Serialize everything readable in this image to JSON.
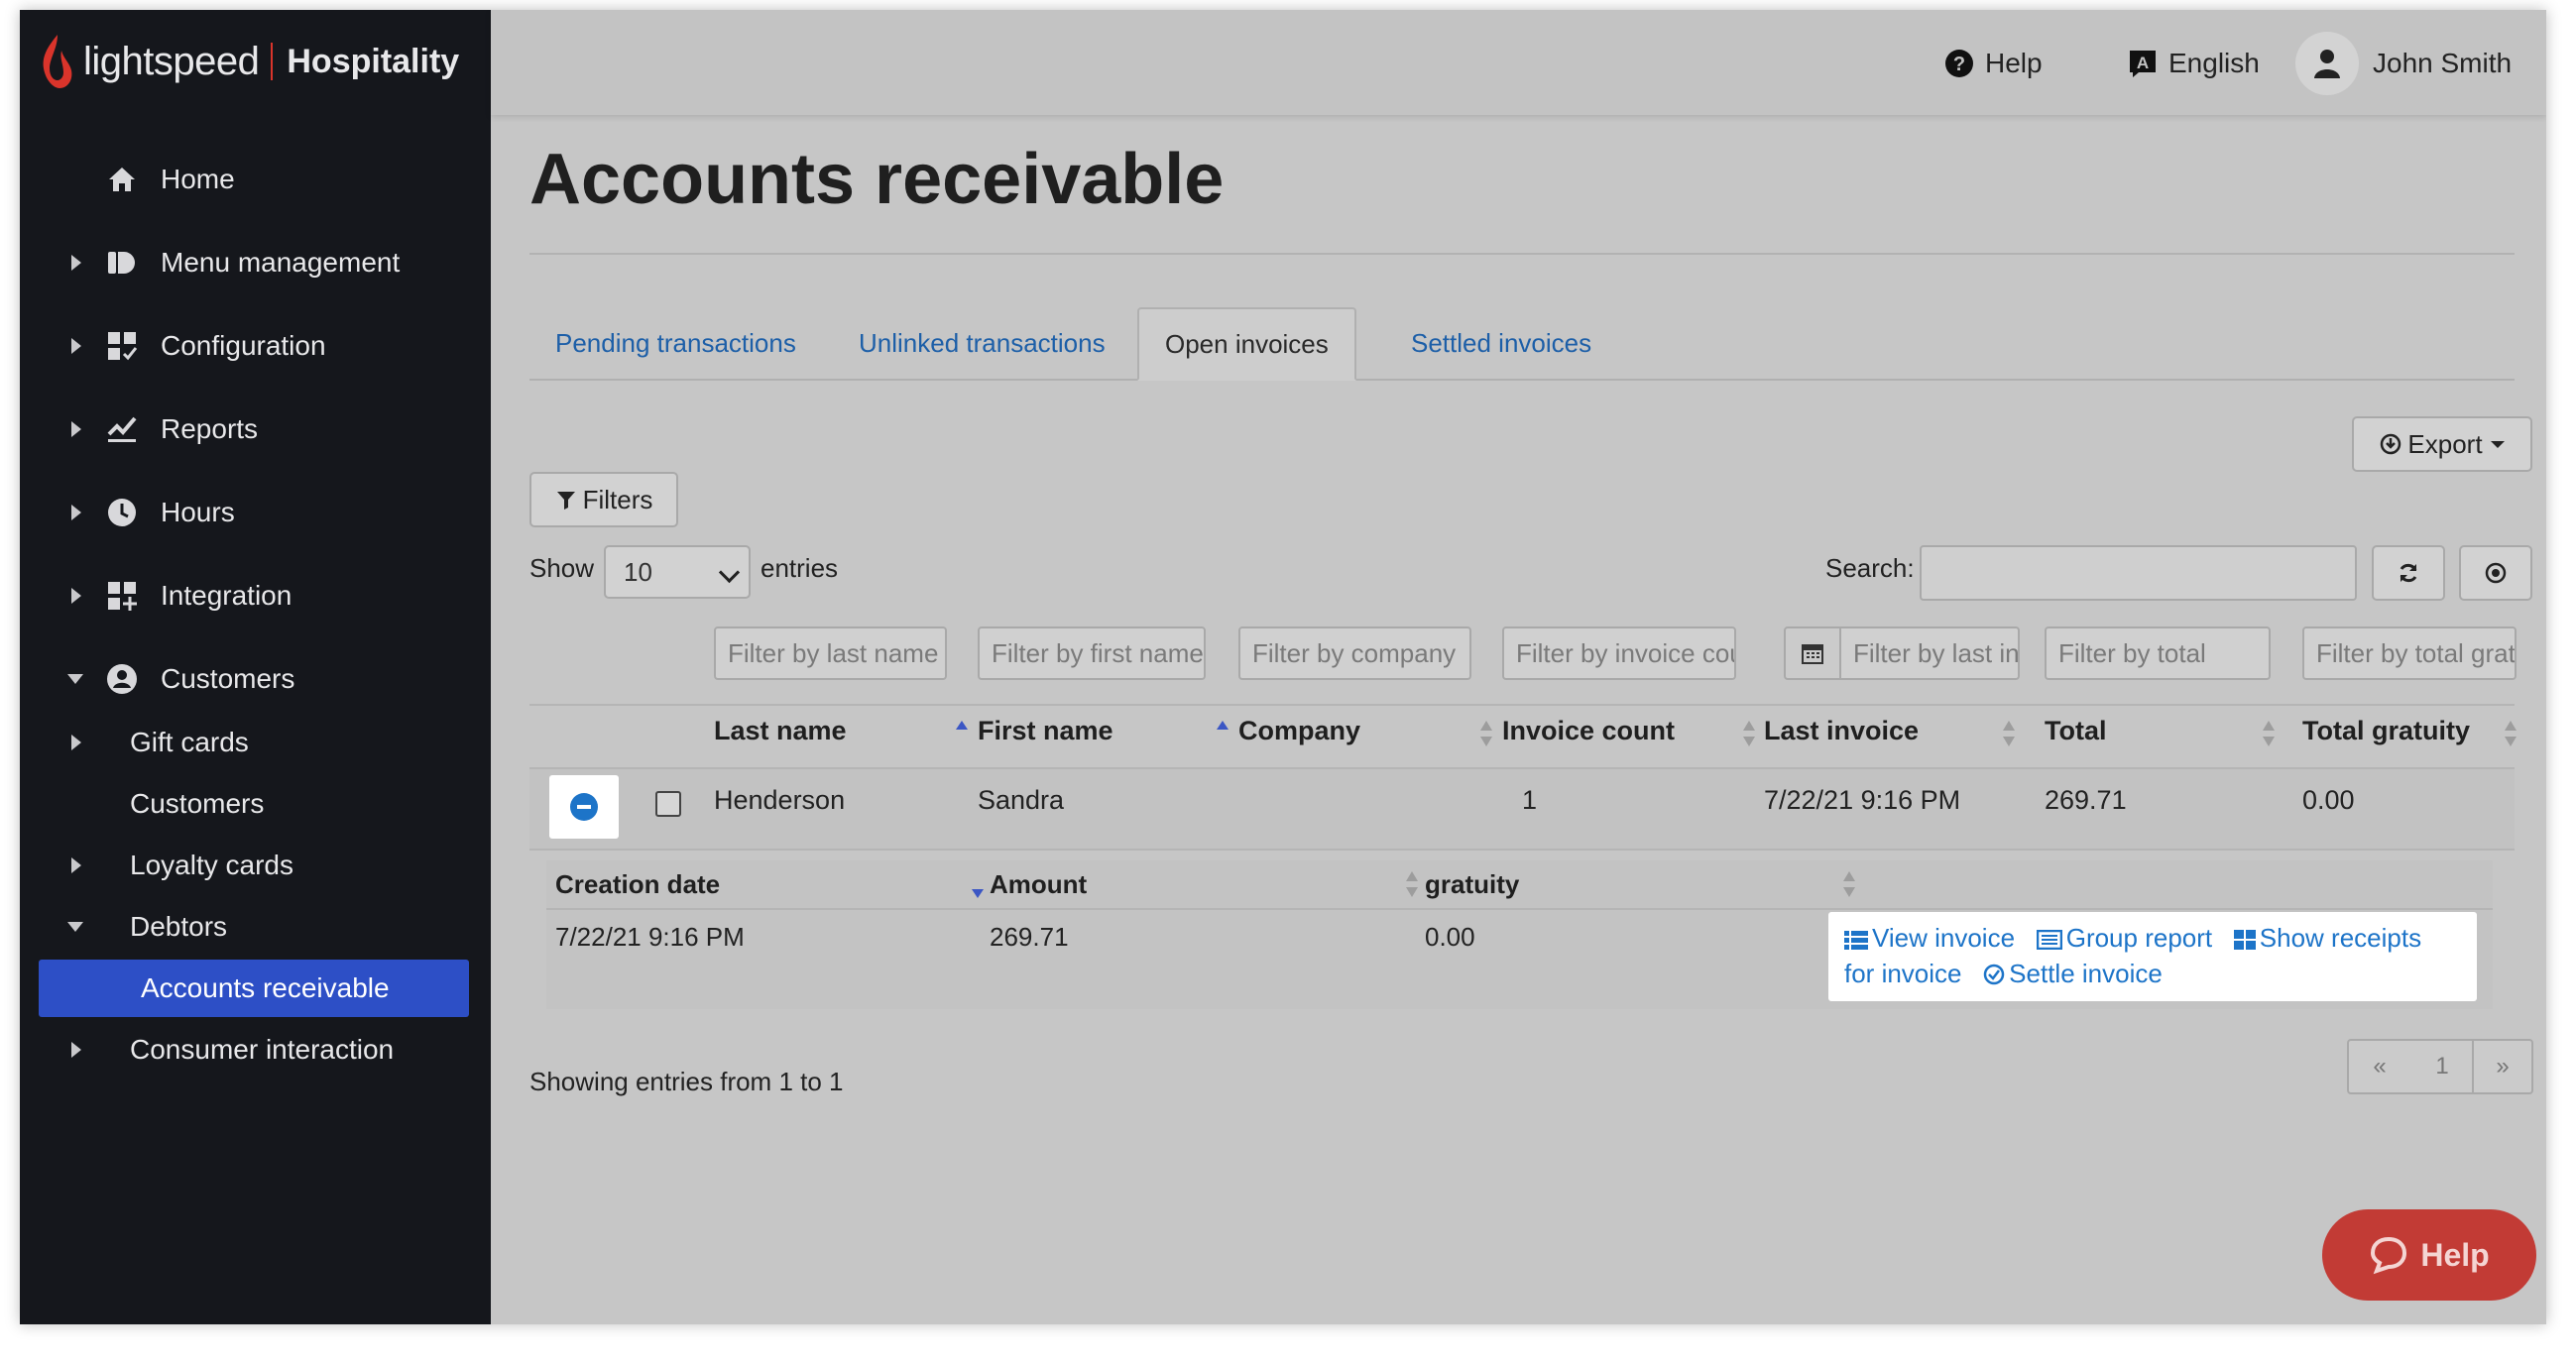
{
  "brand": {
    "logo_text": "lightspeed",
    "product": "Hospitality"
  },
  "topbar": {
    "help": "Help",
    "language": "English",
    "user": "John Smith"
  },
  "sidebar": {
    "items": [
      {
        "label": "Home",
        "icon": "home-icon"
      },
      {
        "label": "Menu management",
        "icon": "menu-management-icon"
      },
      {
        "label": "Configuration",
        "icon": "configuration-icon"
      },
      {
        "label": "Reports",
        "icon": "reports-icon"
      },
      {
        "label": "Hours",
        "icon": "clock-icon"
      },
      {
        "label": "Integration",
        "icon": "integration-icon"
      },
      {
        "label": "Customers",
        "icon": "customer-icon"
      }
    ],
    "sub_items": [
      {
        "label": "Gift cards"
      },
      {
        "label": "Customers"
      },
      {
        "label": "Loyalty cards"
      },
      {
        "label": "Debtors"
      },
      {
        "label": "Accounts receivable"
      },
      {
        "label": "Consumer interaction"
      }
    ]
  },
  "page": {
    "title": "Accounts receivable"
  },
  "tabs": [
    {
      "label": "Pending transactions"
    },
    {
      "label": "Unlinked transactions"
    },
    {
      "label": "Open invoices",
      "active": true
    },
    {
      "label": "Settled invoices"
    }
  ],
  "toolbar": {
    "export": "Export",
    "filters": "Filters",
    "show": "Show",
    "entries_value": "10",
    "entries": "entries",
    "search_label": "Search:",
    "search_value": ""
  },
  "column_filters": {
    "last_name": "Filter by last name",
    "first_name": "Filter by first name",
    "company": "Filter by company",
    "invoice_count": "Filter by invoice count",
    "last_invoice": "Filter by last invoice",
    "total": "Filter by total",
    "total_gratuity": "Filter by total gratuity"
  },
  "table": {
    "headers": [
      "Last name",
      "First name",
      "Company",
      "Invoice count",
      "Last invoice",
      "Total",
      "Total gratuity"
    ],
    "rows": [
      {
        "last_name": "Henderson",
        "first_name": "Sandra",
        "company": "",
        "invoice_count": "1",
        "last_invoice": "7/22/21 9:16 PM",
        "total": "269.71",
        "total_gratuity": "0.00"
      }
    ]
  },
  "detail": {
    "headers": [
      "Creation date",
      "Amount",
      "gratuity"
    ],
    "row": {
      "creation_date": "7/22/21 9:16 PM",
      "amount": "269.71",
      "gratuity": "0.00"
    },
    "actions": {
      "view_invoice": "View invoice",
      "group_report": "Group report",
      "show_receipts": "Show receipts",
      "for_invoice": "for invoice",
      "settle_invoice": "Settle invoice"
    }
  },
  "footer": {
    "showing": "Showing entries from 1 to 1",
    "prev": "«",
    "page": "1",
    "next": "»"
  },
  "help_button": "Help",
  "colors": {
    "accent_blue": "#2d4fc6",
    "link": "#1d74c8",
    "help_red": "#c23b35",
    "sidebar_bg": "#15171c"
  }
}
